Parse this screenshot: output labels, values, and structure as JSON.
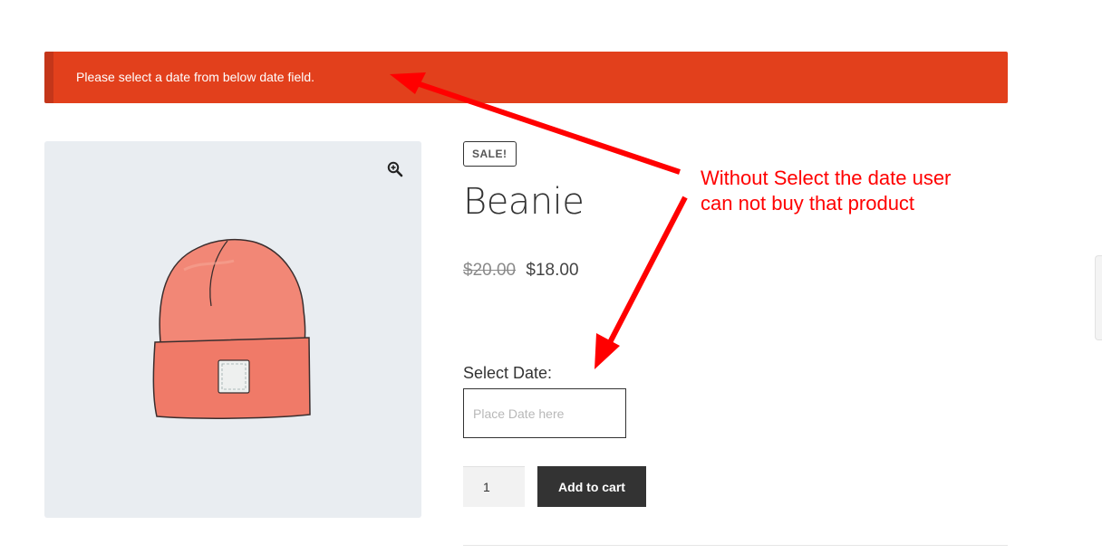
{
  "notice": {
    "text": "Please select a date from below date field."
  },
  "gallery": {
    "zoom_icon": "zoom-in-icon",
    "product_image": "beanie-hat"
  },
  "product": {
    "badge": "SALE!",
    "title": "Beanie",
    "regular_price": "$20.00",
    "sale_price": "$18.00"
  },
  "form": {
    "date_label": "Select Date:",
    "date_placeholder": "Place Date here",
    "quantity": "1",
    "add_to_cart_label": "Add to cart"
  },
  "annotation": {
    "line1": "Without Select the date user",
    "line2": "can not buy that product"
  },
  "colors": {
    "notice_bg": "#e2401c",
    "button_bg": "#333333",
    "annotation": "#ff0000",
    "beanie": "#f08070"
  }
}
